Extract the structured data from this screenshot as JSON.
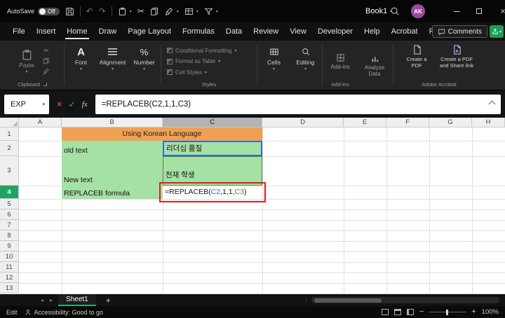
{
  "titlebar": {
    "autosave_label": "AutoSave",
    "autosave_state": "Off",
    "document_title": "Book1 -",
    "avatar_initials": "AK"
  },
  "ribbon_tabs": [
    {
      "label": "File",
      "active": false
    },
    {
      "label": "Insert",
      "active": false
    },
    {
      "label": "Home",
      "active": true
    },
    {
      "label": "Draw",
      "active": false
    },
    {
      "label": "Page Layout",
      "active": false
    },
    {
      "label": "Formulas",
      "active": false
    },
    {
      "label": "Data",
      "active": false
    },
    {
      "label": "Review",
      "active": false
    },
    {
      "label": "View",
      "active": false
    },
    {
      "label": "Developer",
      "active": false
    },
    {
      "label": "Help",
      "active": false
    },
    {
      "label": "Acrobat",
      "active": false
    },
    {
      "label": "Power Pivot",
      "active": false
    }
  ],
  "comments_label": "Comments",
  "ribbon": {
    "paste_label": "Paste",
    "font_label": "Font",
    "alignment_label": "Alignment",
    "number_label": "Number",
    "styles_items": [
      "Conditional Formatting",
      "Format as Table",
      "Cell Styles"
    ],
    "cells_label": "Cells",
    "editing_label": "Editing",
    "addins_label": "Add-ins",
    "analyze_label": "Analyze Data",
    "acrobat_buttons": [
      "Create a PDF",
      "Create a PDF and Share link"
    ],
    "group_labels": {
      "clipboard": "Clipboard",
      "styles": "Styles",
      "addins": "Add-ins",
      "acrobat": "Adobe Acrobat"
    }
  },
  "formula_bar": {
    "name_box": "EXP",
    "fx_label": "fx",
    "formula": "=REPLACEB(C2,1,1,C3)"
  },
  "grid": {
    "column_headers": [
      "A",
      "B",
      "C",
      "D",
      "E",
      "F",
      "G",
      "H"
    ],
    "row_headers": [
      "1",
      "2",
      "3",
      "4",
      "5",
      "6",
      "7",
      "8",
      "9",
      "10",
      "11",
      "12",
      "13"
    ],
    "active_column": "C",
    "active_row": "4",
    "cells": {
      "merged_title": "Using Korean Language",
      "old_text_label": "old text",
      "old_text_value": "리더십 품질",
      "new_text_label": "New text",
      "new_text_value": "천재 학생",
      "formula_label": "REPLACEB formula",
      "formula_parts": [
        {
          "text": "=REPLACEB(",
          "color": "#1a1a1a"
        },
        {
          "text": "C2",
          "color": "#2b6fd3"
        },
        {
          "text": ",1,1,",
          "color": "#1a1a1a"
        },
        {
          "text": "C3",
          "color": "#548235"
        },
        {
          "text": ")",
          "color": "#1a1a1a"
        }
      ]
    },
    "colors": {
      "green_fill": "#a5e0a5",
      "orange_fill": "#f0a053",
      "ref1_border": "#2b6fd3",
      "ref2_border": "#548235",
      "annotation_border": "#e21b1b"
    }
  },
  "sheet_bar": {
    "active_tab": "Sheet1",
    "add_button": "+"
  },
  "status_bar": {
    "mode": "Edit",
    "accessibility": "Accessibility: Good to go",
    "zoom": "100%"
  }
}
